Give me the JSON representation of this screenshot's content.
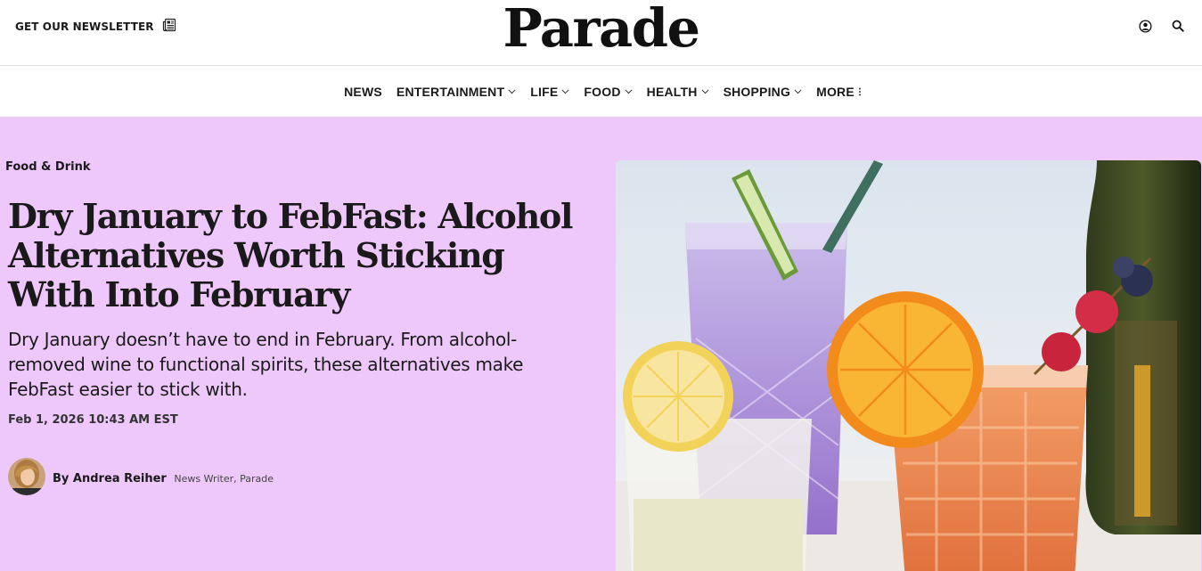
{
  "header": {
    "newsletter_label": "GET OUR NEWSLETTER",
    "logo_text": "Parade"
  },
  "nav": {
    "items": [
      {
        "label": "NEWS",
        "has_dropdown": false
      },
      {
        "label": "ENTERTAINMENT",
        "has_dropdown": true
      },
      {
        "label": "LIFE",
        "has_dropdown": true
      },
      {
        "label": "FOOD",
        "has_dropdown": true
      },
      {
        "label": "HEALTH",
        "has_dropdown": true
      },
      {
        "label": "SHOPPING",
        "has_dropdown": true
      },
      {
        "label": "MORE",
        "has_dropdown": false
      }
    ]
  },
  "article": {
    "category": "Food & Drink",
    "headline": "Dry January to FebFast: Alcohol Alternatives Worth Sticking With Into February",
    "dek": "Dry January doesn’t have to end in February. From alcohol-removed wine to functional spirits, these alternatives make FebFast easier to stick with.",
    "date": "Feb 1, 2026 10:43 AM EST",
    "author": {
      "by_prefix": "By",
      "name": "Andrea Reiher",
      "role": "News Writer, Parade"
    }
  },
  "icons": {
    "newsletter": "newsletter-icon",
    "account": "user-icon",
    "search": "search-icon",
    "dropdown": "chevron-down-icon",
    "more": "more-dots-icon"
  },
  "colors": {
    "hero_background": "#efc8fb",
    "text": "#1a1a1a"
  }
}
